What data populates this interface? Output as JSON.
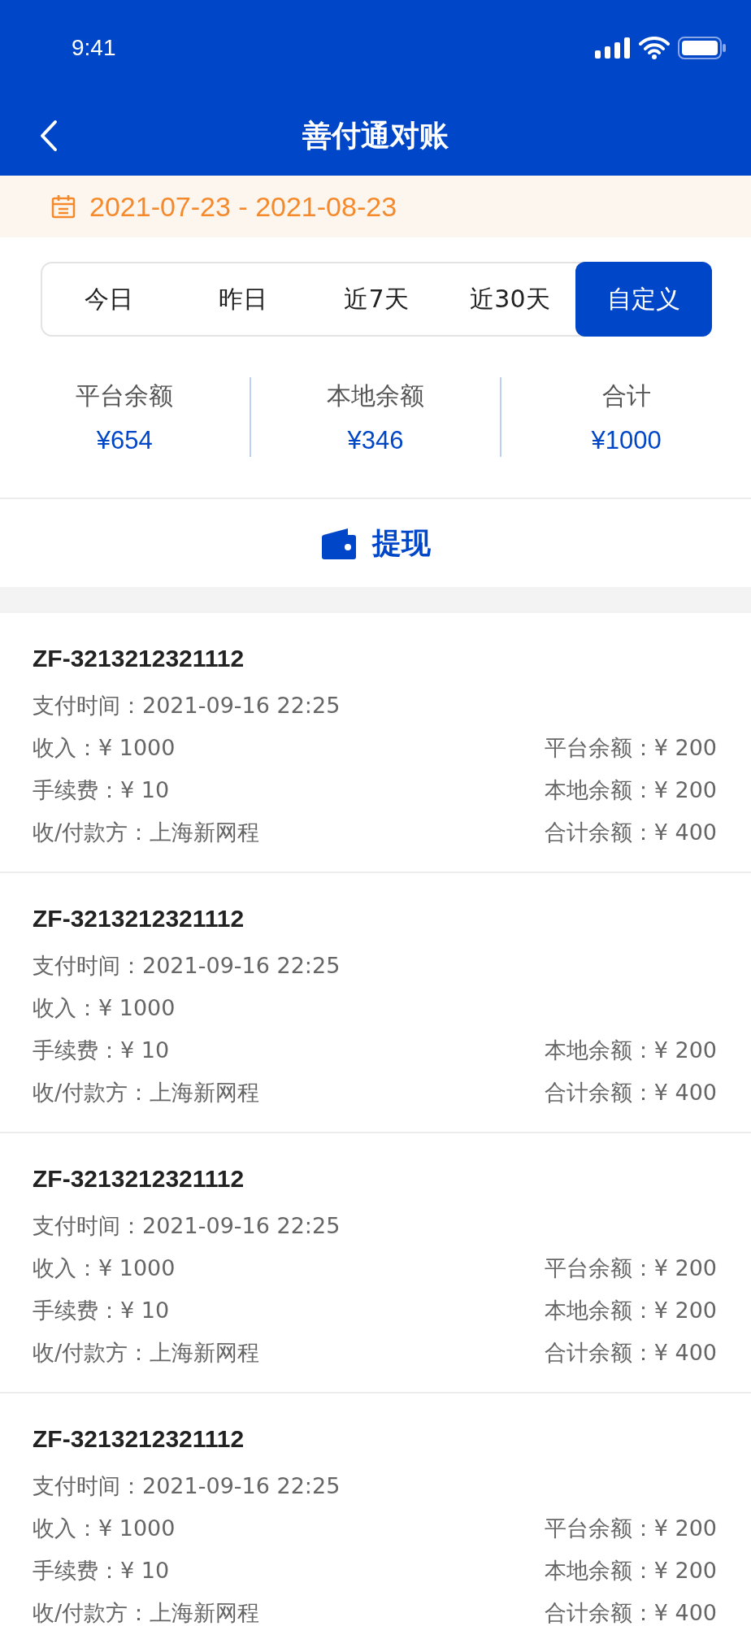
{
  "status_bar": {
    "time": "9:41"
  },
  "header": {
    "title": "善付通对账"
  },
  "date_range": "2021-07-23 - 2021-08-23",
  "tabs": [
    {
      "label": "今日",
      "selected": false
    },
    {
      "label": "昨日",
      "selected": false
    },
    {
      "label": "近7天",
      "selected": false
    },
    {
      "label": "近30天",
      "selected": false
    },
    {
      "label": "自定义",
      "selected": true
    }
  ],
  "summary": [
    {
      "label": "平台余额",
      "value": "¥654"
    },
    {
      "label": "本地余额",
      "value": "¥346"
    },
    {
      "label": "合计",
      "value": "¥1000"
    }
  ],
  "withdraw_button": "提现",
  "records": [
    {
      "id": "ZF-3213212321112",
      "rows": [
        {
          "left": "支付时间：2021-09-16 22:25"
        },
        {
          "left": "收入：¥ 1000",
          "right": "平台余额：¥ 200"
        },
        {
          "left": "手续费：¥ 10",
          "right": "本地余额：¥ 200"
        },
        {
          "left": "收/付款方：上海新网程",
          "right": "合计余额：¥ 400"
        }
      ]
    },
    {
      "id": "ZF-3213212321112",
      "rows": [
        {
          "left": "支付时间：2021-09-16 22:25"
        },
        {
          "left": "收入：¥ 1000"
        },
        {
          "left": "手续费：¥ 10",
          "right": "本地余额：¥ 200"
        },
        {
          "left": "收/付款方：上海新网程",
          "right": "合计余额：¥ 400"
        }
      ]
    },
    {
      "id": "ZF-3213212321112",
      "rows": [
        {
          "left": "支付时间：2021-09-16 22:25"
        },
        {
          "left": "收入：¥ 1000",
          "right": "平台余额：¥ 200"
        },
        {
          "left": "手续费：¥ 10",
          "right": "本地余额：¥ 200"
        },
        {
          "left": "收/付款方：上海新网程",
          "right": "合计余额：¥ 400"
        }
      ]
    },
    {
      "id": "ZF-3213212321112",
      "rows": [
        {
          "left": "支付时间：2021-09-16 22:25"
        },
        {
          "left": "收入：¥ 1000",
          "right": "平台余额：¥ 200"
        },
        {
          "left": "手续费：¥ 10",
          "right": "本地余额：¥ 200"
        },
        {
          "left": "收/付款方：上海新网程",
          "right": "合计余额：¥ 400"
        }
      ]
    }
  ]
}
